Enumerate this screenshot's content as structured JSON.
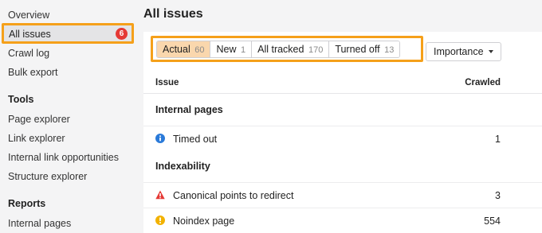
{
  "sidebar": {
    "items_top": [
      "Overview",
      "Crawl log",
      "Bulk export"
    ],
    "active_item": {
      "label": "All issues",
      "badge": "6"
    },
    "tools_heading": "Tools",
    "tools": [
      "Page explorer",
      "Link explorer",
      "Internal link opportunities",
      "Structure explorer"
    ],
    "reports_heading": "Reports",
    "reports": [
      "Internal pages"
    ]
  },
  "main": {
    "title": "All issues",
    "tabs": [
      {
        "label": "Actual",
        "count": "60"
      },
      {
        "label": "New",
        "count": "1"
      },
      {
        "label": "All tracked",
        "count": "170"
      },
      {
        "label": "Turned off",
        "count": "13"
      }
    ],
    "importance_label": "Importance",
    "table": {
      "col_issue": "Issue",
      "col_crawled": "Crawled",
      "groups": [
        {
          "name": "Internal pages"
        },
        {
          "name": "Indexability"
        }
      ],
      "rows": [
        {
          "label": "Timed out",
          "value": "1",
          "icon": "info-icon",
          "color": "#2a7ad9"
        },
        {
          "label": "Canonical points to redirect",
          "value": "3",
          "icon": "error-icon",
          "color": "#e53935"
        },
        {
          "label": "Noindex page",
          "value": "554",
          "icon": "warning-icon",
          "color": "#f2b200"
        }
      ]
    }
  },
  "colors": {
    "highlight": "#f5a01a",
    "active_tab": "#fad7ad",
    "badge": "#e53935"
  }
}
